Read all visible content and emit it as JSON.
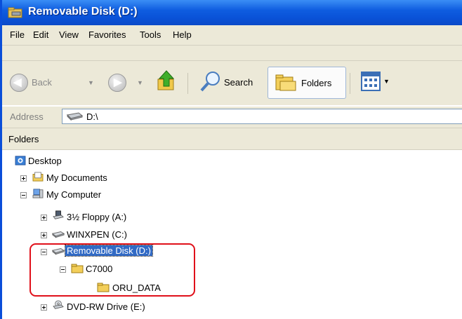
{
  "window": {
    "title": "Removable Disk (D:)",
    "accent": "#0a52d8"
  },
  "menubar": {
    "items": [
      "File",
      "Edit",
      "View",
      "Favorites",
      "Tools",
      "Help"
    ]
  },
  "toolbar": {
    "back_label": "Back",
    "search_label": "Search",
    "folders_label": "Folders"
  },
  "address": {
    "label": "Address",
    "value": "D:\\"
  },
  "folders_pane": {
    "title": "Folders"
  },
  "tree": {
    "desktop": "Desktop",
    "my_documents": "My Documents",
    "my_computer": "My Computer",
    "floppy": "3½ Floppy (A:)",
    "winxpen": "WINXPEN (C:)",
    "removable": "Removable Disk (D:)",
    "c7000": "C7000",
    "oru_data": "ORU_DATA",
    "dvd": "DVD-RW Drive (E:)"
  },
  "highlight_color": "#e0101a"
}
